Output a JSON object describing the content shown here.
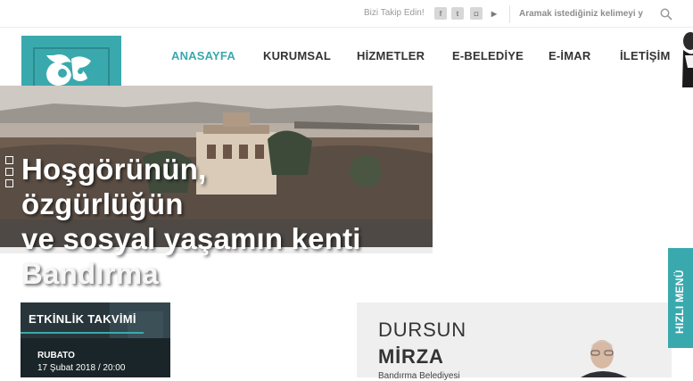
{
  "topbar": {
    "follow_label": "Bizi Takip Edin!",
    "social": [
      {
        "icon": "facebook-icon",
        "glyph": "f"
      },
      {
        "icon": "twitter-icon",
        "glyph": "t"
      },
      {
        "icon": "instagram-icon",
        "glyph": "◘"
      },
      {
        "icon": "youtube-icon",
        "glyph": "▶"
      }
    ],
    "search_placeholder": "Aramak istediğiniz kelimeyi y"
  },
  "nav": {
    "items": [
      {
        "label": "ANASAYFA",
        "active": true
      },
      {
        "label": "KURUMSAL",
        "active": false
      },
      {
        "label": "HİZMETLER",
        "active": false
      },
      {
        "label": "E-BELEDİYE",
        "active": false
      },
      {
        "label": "E-İMAR",
        "active": false
      },
      {
        "label": "İLETİŞİM",
        "active": false
      }
    ]
  },
  "hero": {
    "line1": "Hoşgörünün,",
    "line2": "özgürlüğün",
    "line3": "ve sosyal yaşamın kenti",
    "city": "Bandırma"
  },
  "events": {
    "header": "ETKİNLİK TAKVİMİ",
    "name": "RUBATO",
    "date": "17 Şubat 2018 / 20:00"
  },
  "mayor": {
    "first_name": "DURSUN",
    "last_name": "MİRZA",
    "role": "Bandırma Belediyesi"
  },
  "quick_menu": {
    "label": "HIZLI MENÜ"
  },
  "colors": {
    "accent": "#3aa9ad"
  }
}
